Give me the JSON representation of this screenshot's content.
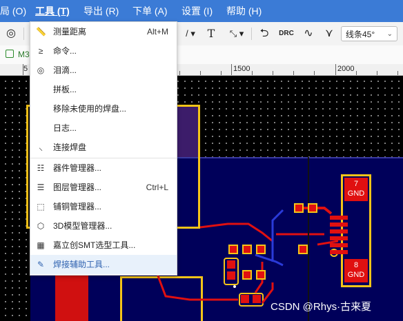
{
  "menubar": {
    "items": [
      {
        "label": "局 (O)"
      },
      {
        "label": "工具 (T)"
      },
      {
        "label": "导出 (R)"
      },
      {
        "label": "下单 (A)"
      },
      {
        "label": "设置 (I)"
      },
      {
        "label": "帮助 (H)"
      }
    ]
  },
  "toolbar": {
    "drc_label": "DRC",
    "text_tool_glyph": "T",
    "routing_select": {
      "value": "线条45°"
    }
  },
  "tabrow": {
    "tab_label": "M3"
  },
  "ruler": {
    "labels": [
      "5",
      "1500",
      "2000"
    ]
  },
  "tools_menu": {
    "items": [
      {
        "label": "测量距离",
        "shortcut": "Alt+M",
        "icon": "ruler-icon"
      },
      {
        "label": "命令...",
        "shortcut": "",
        "icon": "command-icon"
      },
      {
        "label": "泪滴...",
        "shortcut": "",
        "icon": "teardrop-icon"
      },
      {
        "label": "拼板...",
        "shortcut": "",
        "icon": ""
      },
      {
        "label": "移除未使用的焊盘...",
        "shortcut": "",
        "icon": ""
      },
      {
        "label": "日志...",
        "shortcut": "",
        "icon": ""
      },
      {
        "label": "连接焊盘",
        "shortcut": "",
        "icon": "connect-pads-icon"
      },
      {
        "label": "器件管理器...",
        "shortcut": "",
        "icon": "component-manager-icon"
      },
      {
        "label": "图层管理器...",
        "shortcut": "Ctrl+L",
        "icon": "layer-manager-icon"
      },
      {
        "label": "铺铜管理器...",
        "shortcut": "",
        "icon": "copper-pour-icon"
      },
      {
        "label": "3D模型管理器...",
        "shortcut": "",
        "icon": "3d-model-icon"
      },
      {
        "label": "嘉立创SMT选型工具...",
        "shortcut": "",
        "icon": "smt-selection-icon"
      },
      {
        "label": "焊接辅助工具...",
        "shortcut": "",
        "icon": "soldering-helper-icon"
      }
    ]
  },
  "pcb": {
    "pad_labels": [
      {
        "number": "7",
        "net": "GND"
      },
      {
        "number": "8",
        "net": "GND"
      }
    ]
  },
  "watermark": "CSDN @Rhys·古来夏",
  "colors": {
    "menubar": "#3b7bd6",
    "board_fill": "#00005a",
    "track_red": "#e01010",
    "silkscreen_yellow": "#f5c518",
    "menu_highlight": "#e8f1fb"
  }
}
